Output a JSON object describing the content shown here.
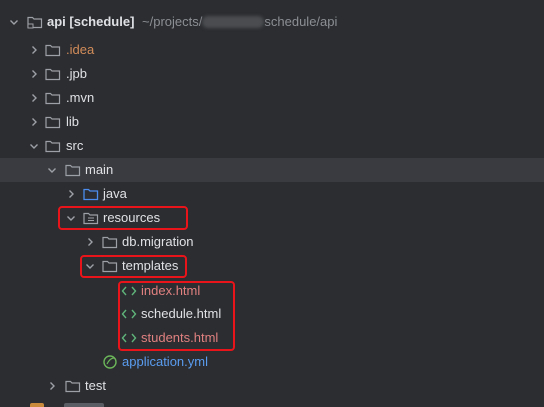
{
  "project": {
    "name": "api [schedule]",
    "path_prefix": "~/projects/",
    "path_suffix": "schedule/api"
  },
  "tree": [
    {
      "label": "api [schedule]",
      "type": "project"
    },
    {
      "label": ".idea",
      "type": "folder"
    },
    {
      "label": ".jpb",
      "type": "folder"
    },
    {
      "label": ".mvn",
      "type": "folder"
    },
    {
      "label": "lib",
      "type": "folder"
    },
    {
      "label": "src",
      "type": "folder"
    },
    {
      "label": "main",
      "type": "folder"
    },
    {
      "label": "java",
      "type": "source-folder"
    },
    {
      "label": "resources",
      "type": "resources-folder"
    },
    {
      "label": "db.migration",
      "type": "folder"
    },
    {
      "label": "templates",
      "type": "folder"
    },
    {
      "label": "index.html",
      "type": "html-file"
    },
    {
      "label": "schedule.html",
      "type": "html-file"
    },
    {
      "label": "students.html",
      "type": "html-file"
    },
    {
      "label": "application.yml",
      "type": "yml-file"
    },
    {
      "label": "test",
      "type": "folder"
    }
  ],
  "colors": {
    "background": "#2b2d30",
    "selected_row": "#393b40",
    "highlight": "#e8141a",
    "text": "#dfe1e5",
    "idea_text": "#d28c5a",
    "html_red_text": "#e08080",
    "yml_text": "#5a9cf0",
    "path_text": "#8c8f94"
  },
  "icons": {
    "chevron_open": "chevron-down-icon",
    "chevron_closed": "chevron-right-icon",
    "folder": "folder-icon",
    "source_folder": "source-folder-icon",
    "resources_folder": "resources-folder-icon",
    "html": "html-file-icon",
    "yml": "spring-yml-icon"
  }
}
